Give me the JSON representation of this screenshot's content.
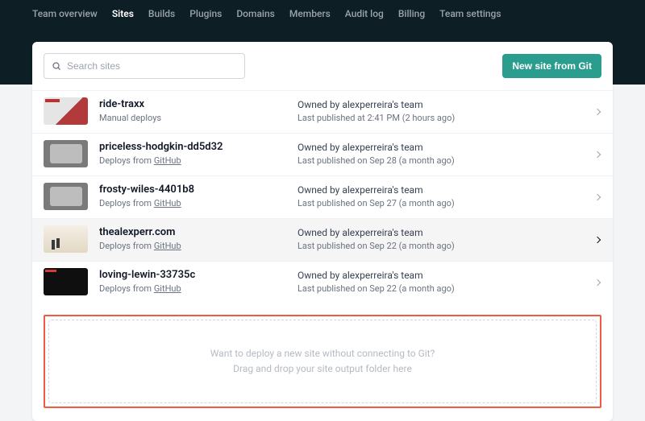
{
  "nav": {
    "items": [
      {
        "label": "Team overview"
      },
      {
        "label": "Sites"
      },
      {
        "label": "Builds"
      },
      {
        "label": "Plugins"
      },
      {
        "label": "Domains"
      },
      {
        "label": "Members"
      },
      {
        "label": "Audit log"
      },
      {
        "label": "Billing"
      },
      {
        "label": "Team settings"
      }
    ],
    "activeIndex": 1
  },
  "search": {
    "placeholder": "Search sites"
  },
  "actions": {
    "newSite": "New site from Git"
  },
  "github": "GitHub",
  "sites": [
    {
      "name": "ride-traxx",
      "sub": "Manual deploys",
      "subLink": null,
      "owner": "Owned by alexperreira's team",
      "published": "Last published at 2:41 PM (2 hours ago)"
    },
    {
      "name": "priceless-hodgkin-dd5d32",
      "sub": "Deploys from ",
      "subLink": "GitHub",
      "owner": "Owned by alexperreira's team",
      "published": "Last published on Sep 28 (a month ago)"
    },
    {
      "name": "frosty-wiles-4401b8",
      "sub": "Deploys from ",
      "subLink": "GitHub",
      "owner": "Owned by alexperreira's team",
      "published": "Last published on Sep 27 (a month ago)"
    },
    {
      "name": "thealexperr.com",
      "sub": "Deploys from ",
      "subLink": "GitHub",
      "owner": "Owned by alexperreira's team",
      "published": "Last published on Sep 22 (a month ago)"
    },
    {
      "name": "loving-lewin-33735c",
      "sub": "Deploys from ",
      "subLink": "GitHub",
      "owner": "Owned by alexperreira's team",
      "published": "Last published on Sep 22 (a month ago)"
    }
  ],
  "dropzone": {
    "line1": "Want to deploy a new site without connecting to Git?",
    "line2": "Drag and drop your site output folder here"
  }
}
